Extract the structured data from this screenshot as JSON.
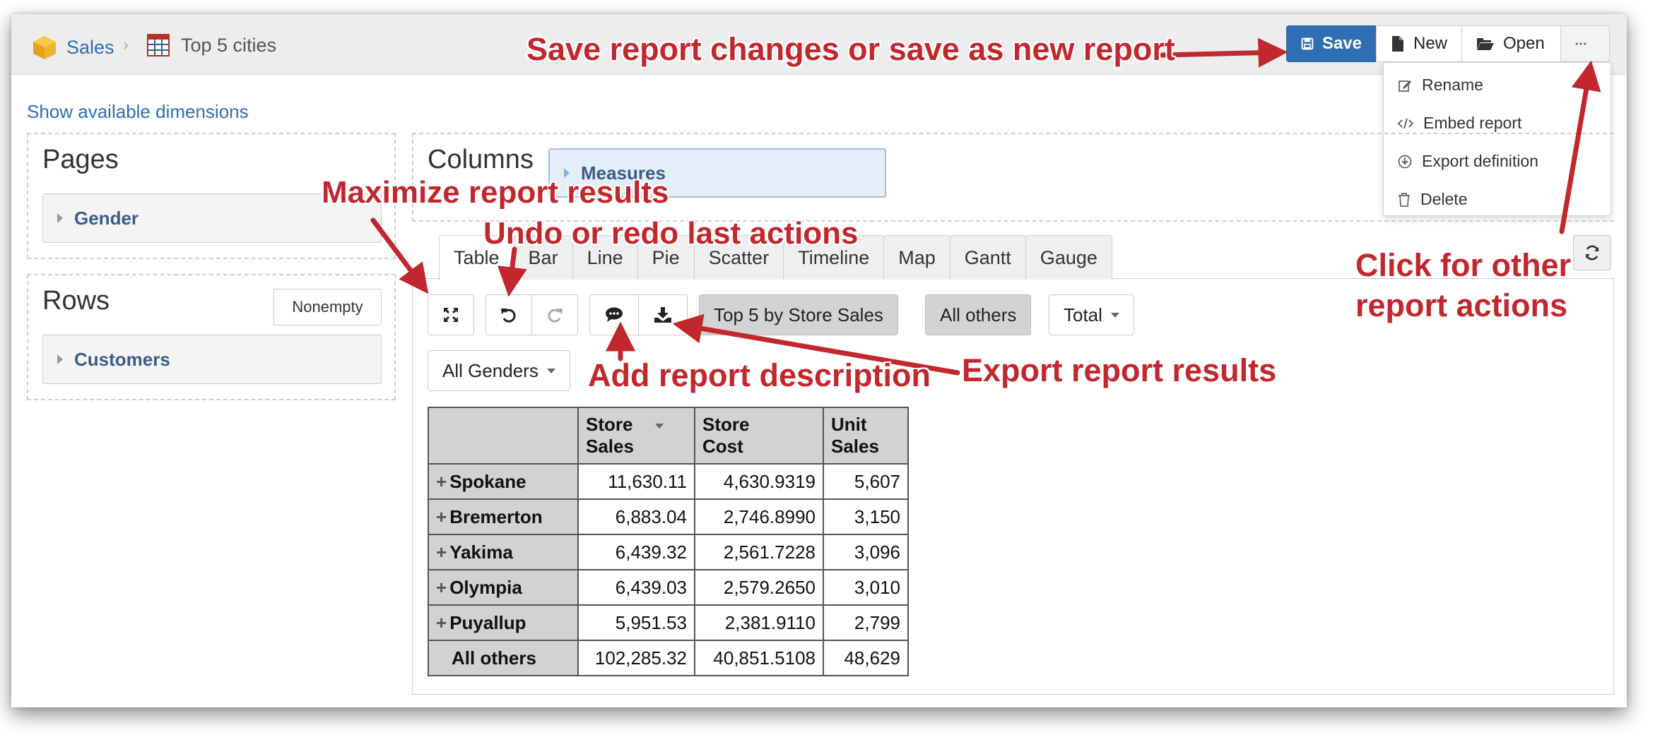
{
  "breadcrumb": {
    "cube": "Sales",
    "report": "Top 5 cities"
  },
  "toolbar": {
    "save": "Save",
    "new": "New",
    "open": "Open",
    "more": "•••"
  },
  "more_menu": [
    "Rename",
    "Embed report",
    "Export definition",
    "Delete"
  ],
  "show_dimensions": "Show available dimensions",
  "pages": {
    "title": "Pages",
    "dimension": "Gender"
  },
  "rows": {
    "title": "Rows",
    "nonempty": "Nonempty",
    "dimension": "Customers"
  },
  "columns": {
    "title": "Columns",
    "dimension": "Measures"
  },
  "tabs": [
    "Table",
    "Bar",
    "Line",
    "Pie",
    "Scatter",
    "Timeline",
    "Map",
    "Gantt",
    "Gauge"
  ],
  "active_tab": "Table",
  "filters": {
    "top": "Top 5 by Store Sales",
    "others": "All others",
    "total": "Total",
    "gender": "All Genders"
  },
  "table": {
    "headers": [
      [
        "Store",
        "Sales"
      ],
      [
        "Store",
        "Cost"
      ],
      [
        "Unit",
        "Sales"
      ]
    ],
    "rows": [
      {
        "label": "Spokane",
        "values": [
          "11,630.11",
          "4,630.9319",
          "5,607"
        ]
      },
      {
        "label": "Bremerton",
        "values": [
          "6,883.04",
          "2,746.8990",
          "3,150"
        ]
      },
      {
        "label": "Yakima",
        "values": [
          "6,439.32",
          "2,561.7228",
          "3,096"
        ]
      },
      {
        "label": "Olympia",
        "values": [
          "6,439.03",
          "2,579.2650",
          "3,010"
        ]
      },
      {
        "label": "Puyallup",
        "values": [
          "5,951.53",
          "2,381.9110",
          "2,799"
        ]
      },
      {
        "label": "All others",
        "values": [
          "102,285.32",
          "40,851.5108",
          "48,629"
        ]
      }
    ]
  },
  "annotations": {
    "save": "Save report changes or save as new report",
    "maximize": "Maximize report results",
    "undo": "Undo or redo last actions",
    "description": "Add report description",
    "export": "Export report results",
    "other_line1": "Click for other",
    "other_line2": "report actions"
  },
  "colors": {
    "accent": "#2f6eb3",
    "annotation": "#c1272d",
    "header_bg": "#d2d2d2"
  }
}
